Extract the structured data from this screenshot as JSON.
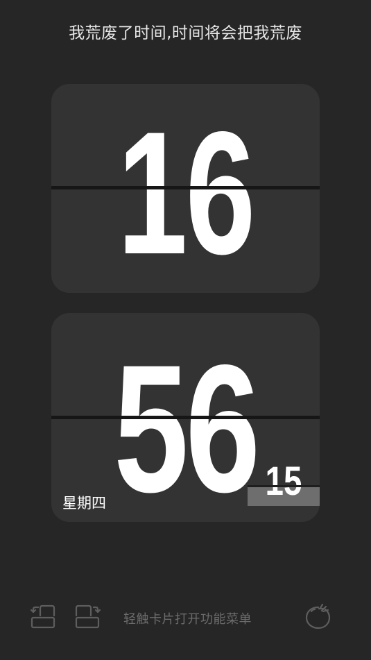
{
  "quote": "我荒废了时间,时间将会把我荒废",
  "clock": {
    "hours": "16",
    "minutes": "56",
    "seconds": "15",
    "weekday": "星期四"
  },
  "toolbar": {
    "hint": "轻触卡片打开功能菜单",
    "icons": [
      "rotate-left-icon",
      "rotate-right-icon",
      "tomato-timer-icon"
    ]
  },
  "colors": {
    "background": "#262626",
    "card": "#333333",
    "digits": "#ffffff",
    "hint": "#6c6c6c"
  }
}
